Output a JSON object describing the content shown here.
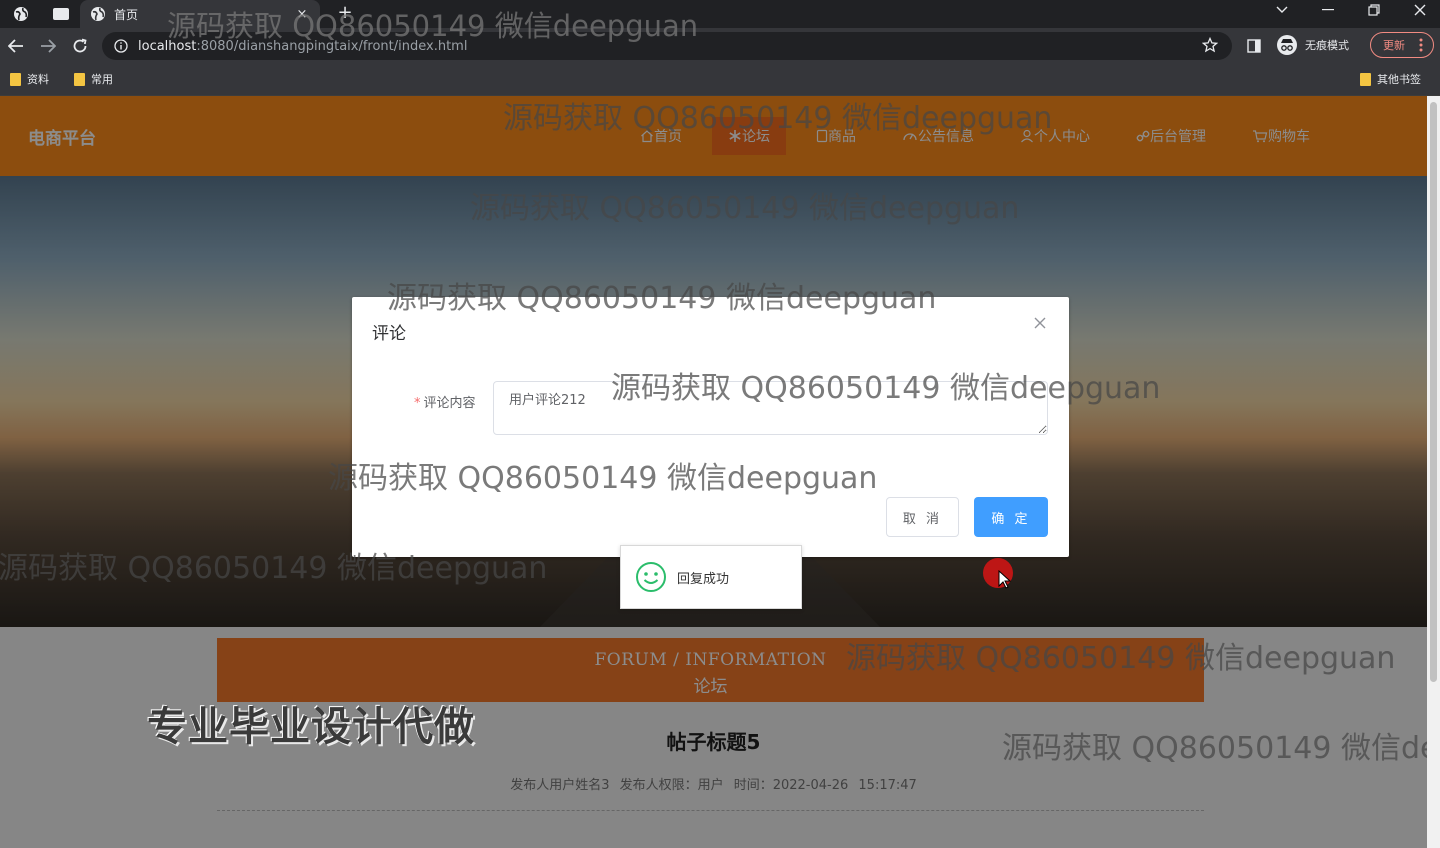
{
  "browser": {
    "tab_title": "首页",
    "tab_close": "×",
    "new_tab": "+",
    "url_host": "localhost",
    "url_rest": ":8080/dianshangpingtaix/front/index.html",
    "incognito_label": "无痕模式",
    "update_label": "更新",
    "bookmarks": [
      "资料",
      "常用"
    ],
    "other_bookmarks": "其他书签"
  },
  "site": {
    "brand": "电商平台",
    "nav": [
      {
        "icon": "home-icon",
        "label": "首页",
        "active": false
      },
      {
        "icon": "snowflake-icon",
        "label": "论坛",
        "active": true
      },
      {
        "icon": "goods-icon",
        "label": "商品",
        "active": false
      },
      {
        "icon": "gauge-icon",
        "label": "公告信息",
        "active": false
      },
      {
        "icon": "user-icon",
        "label": "个人中心",
        "active": false
      },
      {
        "icon": "link-icon",
        "label": "后台管理",
        "active": false
      },
      {
        "icon": "cart-icon",
        "label": "购物车",
        "active": false
      }
    ],
    "section_en": "FORUM / INFORMATION",
    "section_cn": "论坛",
    "post_title": "帖子标题5",
    "post_meta": "发布人用户姓名3 发布人权限：用户 时间：2022-04-26 15:17:47"
  },
  "dialog": {
    "title": "评论",
    "close": "×",
    "field_label": "评论内容",
    "required_mark": "*",
    "field_value": "用户评论212",
    "cancel_label": "取 消",
    "confirm_label": "确 定",
    "primary_color": "#409eff"
  },
  "toast": {
    "icon": "smiley-icon",
    "message": "回复成功"
  },
  "watermarks": {
    "text": "源码获取 QQ86050149 微信deepguan",
    "clipped": "源码获取 QQ86050149 微信dee",
    "promo": "专业毕业设计代做"
  },
  "colors": {
    "header": "#ff8c1a",
    "nav_active": "#f76e1e",
    "banner": "#f5782a"
  }
}
